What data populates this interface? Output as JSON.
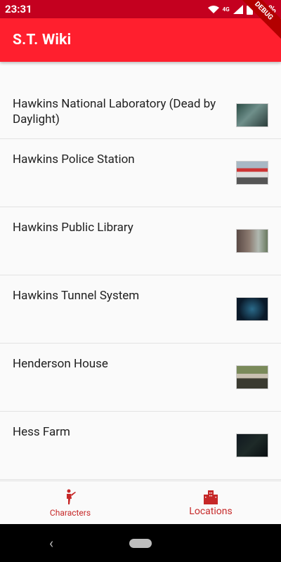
{
  "status": {
    "time": "23:31",
    "network": "4G",
    "battery": "83%"
  },
  "app": {
    "title": "S.T. Wiki",
    "debug": "DEBUG"
  },
  "locations": [
    {
      "name": "Hawkins National Laboratory (Dead by Daylight)",
      "thumb": "thumb-lab"
    },
    {
      "name": "Hawkins Police Station",
      "thumb": "thumb-police"
    },
    {
      "name": "Hawkins Public Library",
      "thumb": "thumb-library"
    },
    {
      "name": "Hawkins Tunnel System",
      "thumb": "thumb-tunnel"
    },
    {
      "name": "Henderson House",
      "thumb": "thumb-henderson"
    },
    {
      "name": "Hess Farm",
      "thumb": "thumb-hess"
    }
  ],
  "bottom_nav": {
    "characters": "Characters",
    "locations": "Locations"
  },
  "colors": {
    "status_bar": "#c4001f",
    "app_bar": "#ff1f2e",
    "accent": "#c62828"
  }
}
